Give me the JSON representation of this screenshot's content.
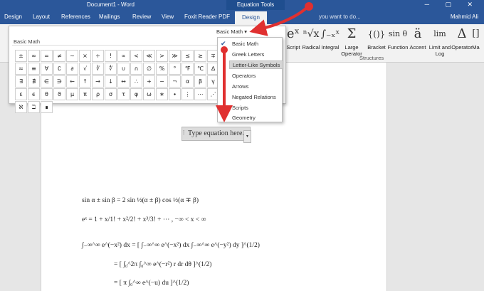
{
  "titlebar": {
    "document_title": "Document1 - Word",
    "equation_tools": "Equation Tools",
    "window_controls": "─ ▢ ✕"
  },
  "tabs": [
    "Design",
    "Layout",
    "References",
    "Mailings",
    "Review",
    "View",
    "Foxit Reader PDF",
    "Design"
  ],
  "tell_me": "you want to do...",
  "user_name": "Mahmid Ali",
  "ribbon": {
    "buttons": [
      {
        "icon": "eˣ",
        "label": "Script",
        "has_dropdown": true
      },
      {
        "icon": "ⁿ√x",
        "label": "Radical",
        "has_dropdown": true
      },
      {
        "icon": "∫₋ₓˣ",
        "label": "Integral",
        "has_dropdown": true
      },
      {
        "icon": "Σ",
        "label": "Large Operator",
        "has_dropdown": true
      },
      {
        "icon": "{()}",
        "label": "Bracket",
        "has_dropdown": true
      },
      {
        "icon": "sin θ",
        "label": "Function",
        "has_dropdown": true
      },
      {
        "icon": "ä",
        "label": "Accent",
        "has_dropdown": true
      },
      {
        "icon": "lim",
        "label": "Limit and Log",
        "has_dropdown": true
      },
      {
        "icon": "Δ",
        "label": "Operator",
        "has_dropdown": true
      },
      {
        "icon": "[]",
        "label": "Ma",
        "has_dropdown": false
      }
    ],
    "group_label": "Structures"
  },
  "gallery": {
    "header": "Basic Math",
    "symbols": [
      "±",
      "∞",
      "=",
      "≠",
      "~",
      "×",
      "÷",
      "!",
      "∝",
      "<",
      "≪",
      ">",
      "≫",
      "≤",
      "≥",
      "∓",
      "≅",
      "≈",
      "≡",
      "∀",
      "∁",
      "∂",
      "√",
      "∛",
      "∜",
      "∪",
      "∩",
      "∅",
      "%",
      "°",
      "℉",
      "℃",
      "∆",
      "∇",
      "∃",
      "∄",
      "∈",
      "∋",
      "←",
      "↑",
      "→",
      "↓",
      "↔",
      "∴",
      "+",
      "−",
      "¬",
      "α",
      "β",
      "γ",
      "δ",
      "ε",
      "ϵ",
      "θ",
      "ϑ",
      "μ",
      "π",
      "ρ",
      "σ",
      "τ",
      "φ",
      "ω",
      "∗",
      "∙",
      "⋮",
      "⋯",
      "⋰",
      "⋱",
      "ℵ",
      "ℶ",
      "∎"
    ]
  },
  "dropdown": {
    "trigger_label": "Basic Math",
    "caret": "▾",
    "check": "✔",
    "items": [
      "Basic Math",
      "Greek Letters",
      "Letter-Like Symbols",
      "Operators",
      "Arrows",
      "Negated Relations",
      "Scripts",
      "Geometry"
    ]
  },
  "equation": {
    "handle": "⁞",
    "placeholder": "Type equation here.",
    "caret": "▾"
  },
  "formulas": [
    "sin α ± sin β = 2 sin ½(α ± β) cos ½(α ∓ β)",
    "eˣ = 1 + x/1! + x²/2! + x³/3! + ⋯ ,     −∞ < x < ∞",
    "∫₋∞^∞ e^(−x²) dx = [ ∫₋∞^∞ e^(−x²) dx ∫₋∞^∞ e^(−y²) dy ]^(1/2)",
    "= [ ∫₀^2π ∫₀^∞ e^(−r²) r dr dθ ]^(1/2)",
    "= [ π ∫₀^∞ e^(−u) du ]^(1/2)"
  ],
  "colors": {
    "word_blue": "#2b579a",
    "annotation_red": "#e03030"
  }
}
